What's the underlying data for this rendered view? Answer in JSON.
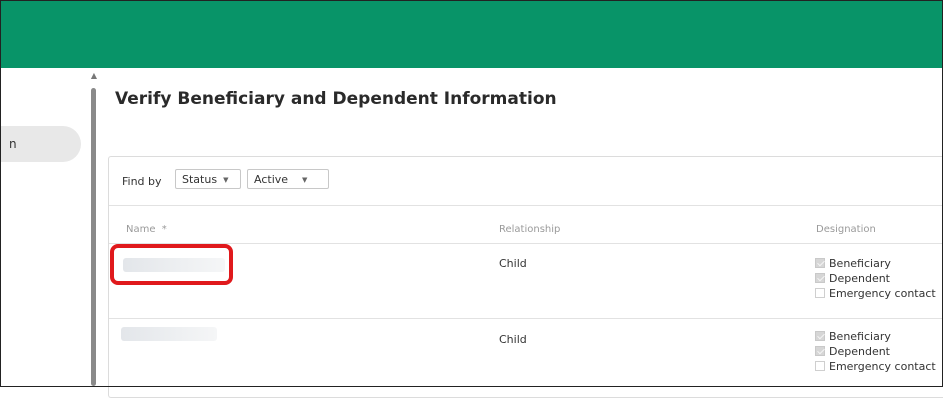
{
  "colors": {
    "topbar": "#089468",
    "highlight": "#e0191c"
  },
  "nav": {
    "active_item_label": "n"
  },
  "page": {
    "title": "Verify Beneficiary and Dependent Information"
  },
  "filters": {
    "find_by_label": "Find by",
    "status_label": "Status",
    "active_label": "Active",
    "caret_icon": "caret-down-icon"
  },
  "table": {
    "columns": {
      "name": "Name",
      "sort_marker": "*",
      "relationship": "Relationship",
      "designation": "Designation"
    },
    "rows": [
      {
        "name": "",
        "relationship": "Child",
        "designations": [
          {
            "label": "Beneficiary",
            "checked": true
          },
          {
            "label": "Dependent",
            "checked": true
          },
          {
            "label": "Emergency contact",
            "checked": false
          }
        ]
      },
      {
        "name": "",
        "relationship": "Child",
        "designations": [
          {
            "label": "Beneficiary",
            "checked": true
          },
          {
            "label": "Dependent",
            "checked": true
          },
          {
            "label": "Emergency contact",
            "checked": false
          }
        ]
      }
    ]
  }
}
